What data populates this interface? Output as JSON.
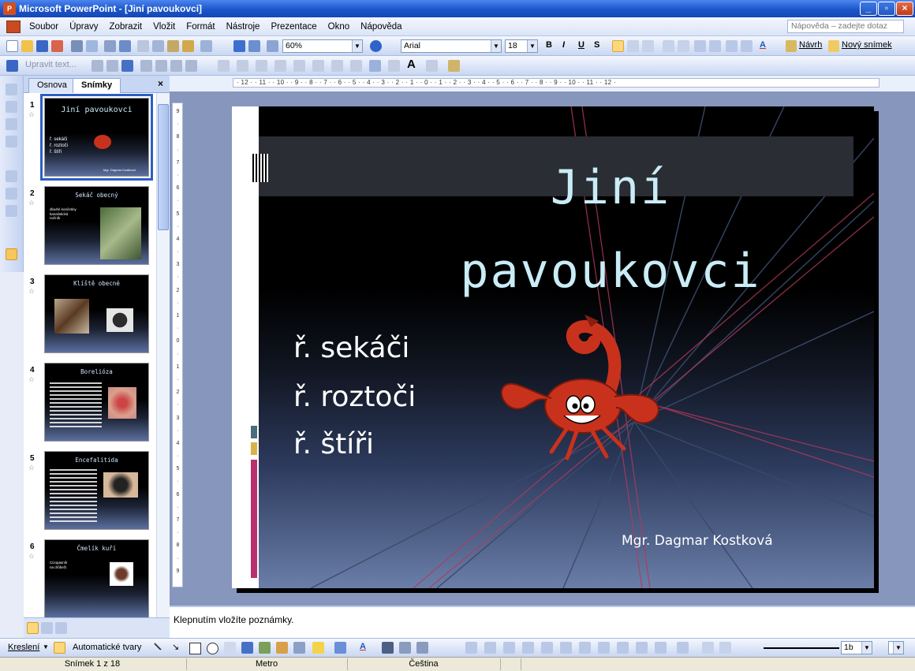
{
  "window": {
    "title": "Microsoft PowerPoint - [Jiní pavoukovci]",
    "app_icon_label": "P"
  },
  "menubar": {
    "items": [
      "Soubor",
      "Úpravy",
      "Zobrazit",
      "Vložit",
      "Formát",
      "Nástroje",
      "Prezentace",
      "Okno",
      "Nápověda"
    ],
    "help_placeholder": "Nápověda – zadejte dotaz"
  },
  "toolbar_standard": {
    "zoom": "60%",
    "font": "Arial",
    "font_size": "18",
    "bold": "B",
    "italic": "I",
    "underline": "U",
    "shadow": "S",
    "design": "Návrh",
    "new_slide": "Nový snímek",
    "font_color_label": "A"
  },
  "toolbar_second": {
    "edit_text": "Upravit text...",
    "text_label": "A"
  },
  "left_pane": {
    "tabs": [
      "Osnova",
      "Snímky"
    ],
    "close": "×",
    "slides": [
      {
        "num": "1",
        "title": "Jiní pavoukovci",
        "body": [
          "ř. sekáči",
          "ř. roztoči",
          "ř. štíři"
        ],
        "footer": "Mgr. Dagmar Kostková",
        "selected": true
      },
      {
        "num": "2",
        "title": "Sekáč obecný",
        "body": [
          "dlouhé končetiny",
          "kanalistická",
          "nočník"
        ]
      },
      {
        "num": "3",
        "title": "Klíště obecné",
        "body": []
      },
      {
        "num": "4",
        "title": "Borelióza",
        "body": []
      },
      {
        "num": "5",
        "title": "Encefalitida",
        "body": []
      },
      {
        "num": "6",
        "title": "Čmelík kuří",
        "body": [
          "Cizopasník",
          "na drůbeži."
        ]
      }
    ]
  },
  "ruler": {
    "horizontal": "· 12 · · 11 · · 10 · · 9 · · 8 · · 7 · · 6 · · 5 · · 4 · · 3 · · 2 · · 1 · · 0 · · 1 · · 2 · · 3 · · 4 · · 5 · · 6 · · 7 · · 8 · · 9 · · 10 · · 11 · · 12 ·",
    "vertical": [
      "9",
      "·",
      "8",
      "·",
      "7",
      "·",
      "6",
      "·",
      "5",
      "·",
      "4",
      "·",
      "3",
      "·",
      "2",
      "·",
      "1",
      "·",
      "0",
      "·",
      "1",
      "·",
      "2",
      "·",
      "3",
      "·",
      "4",
      "·",
      "5",
      "·",
      "6",
      "·",
      "7",
      "·",
      "8",
      "·",
      "9"
    ]
  },
  "slide": {
    "title_line1": "Jiní",
    "title_line2": "pavoukovci",
    "bullets": [
      "ř. sekáči",
      "ř. roztoči",
      "ř. štíři"
    ],
    "author": "Mgr. Dagmar Kostková"
  },
  "notes": {
    "placeholder": "Klepnutím vložíte poznámky."
  },
  "drawbar": {
    "draw": "Kreslení",
    "autoshapes": "Automatické tvary",
    "line_width": "1b"
  },
  "statusbar": {
    "slide": "Snímek 1 z 18",
    "design": "Metro",
    "language": "Čeština"
  },
  "colors": {
    "title_blue": "#1b56c9",
    "accent_blue": "#2d5fc4",
    "slide_title": "#c9ecf6",
    "scorpion_red": "#c8321d"
  }
}
